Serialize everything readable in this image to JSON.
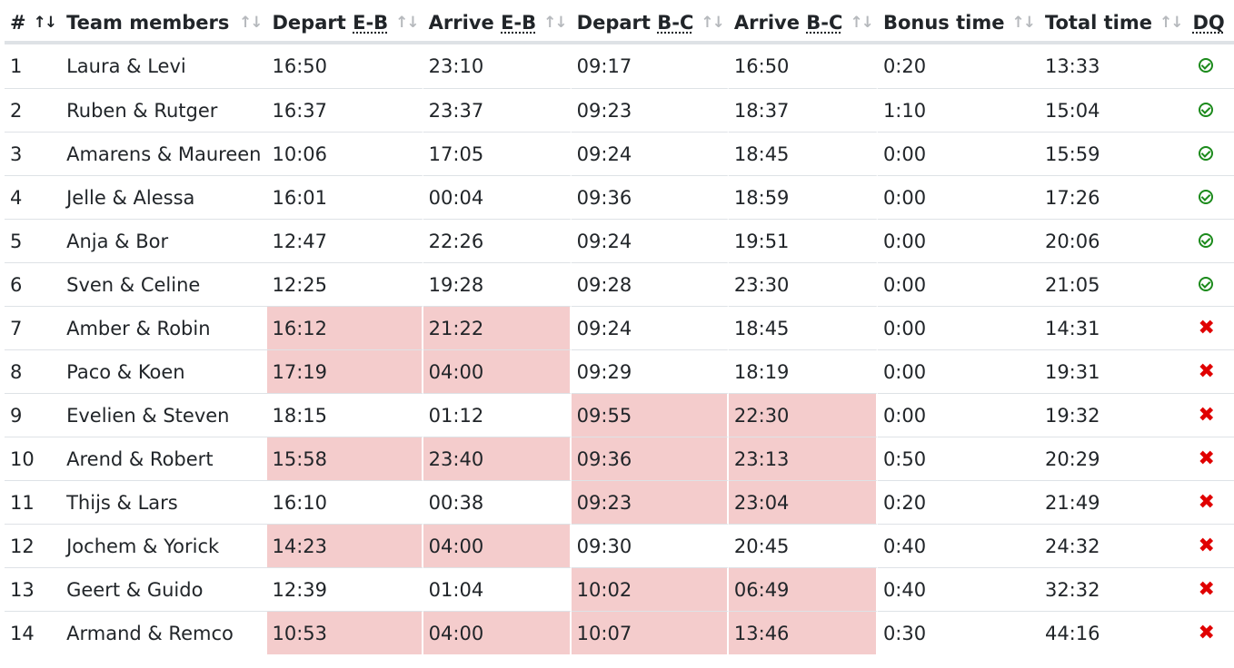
{
  "table": {
    "headers": [
      {
        "name": "col-rank",
        "label": "#",
        "sort": "↑↓",
        "active": true
      },
      {
        "name": "col-team",
        "label": "Team members",
        "sort": "↑↓"
      },
      {
        "name": "col-depart-eb",
        "prefix": "Depart ",
        "abbr": "E-B",
        "sort": "↑↓"
      },
      {
        "name": "col-arrive-eb",
        "prefix": "Arrive ",
        "abbr": "E-B",
        "sort": "↑↓"
      },
      {
        "name": "col-depart-bc",
        "prefix": "Depart ",
        "abbr": "B-C",
        "sort": "↑↓"
      },
      {
        "name": "col-arrive-bc",
        "prefix": "Arrive ",
        "abbr": "B-C",
        "sort": "↑↓"
      },
      {
        "name": "col-bonus",
        "label": "Bonus time",
        "sort": "↑↓"
      },
      {
        "name": "col-total",
        "label": "Total time",
        "sort": "↑↓"
      },
      {
        "name": "col-dq",
        "abbr": "DQ",
        "sort": "↑↓"
      }
    ],
    "rows": [
      {
        "rank": "1",
        "team": "Laura & Levi",
        "depart_eb": "16:50",
        "arrive_eb": "23:10",
        "depart_bc": "09:17",
        "arrive_bc": "16:50",
        "bonus": "0:20",
        "total": "13:33",
        "dq": false,
        "hl_eb": false,
        "hl_bc": false
      },
      {
        "rank": "2",
        "team": "Ruben & Rutger",
        "depart_eb": "16:37",
        "arrive_eb": "23:37",
        "depart_bc": "09:23",
        "arrive_bc": "18:37",
        "bonus": "1:10",
        "total": "15:04",
        "dq": false,
        "hl_eb": false,
        "hl_bc": false
      },
      {
        "rank": "3",
        "team": "Amarens & Maureen",
        "depart_eb": "10:06",
        "arrive_eb": "17:05",
        "depart_bc": "09:24",
        "arrive_bc": "18:45",
        "bonus": "0:00",
        "total": "15:59",
        "dq": false,
        "hl_eb": false,
        "hl_bc": false
      },
      {
        "rank": "4",
        "team": "Jelle & Alessa",
        "depart_eb": "16:01",
        "arrive_eb": "00:04",
        "depart_bc": "09:36",
        "arrive_bc": "18:59",
        "bonus": "0:00",
        "total": "17:26",
        "dq": false,
        "hl_eb": false,
        "hl_bc": false
      },
      {
        "rank": "5",
        "team": "Anja & Bor",
        "depart_eb": "12:47",
        "arrive_eb": "22:26",
        "depart_bc": "09:24",
        "arrive_bc": "19:51",
        "bonus": "0:00",
        "total": "20:06",
        "dq": false,
        "hl_eb": false,
        "hl_bc": false
      },
      {
        "rank": "6",
        "team": "Sven & Celine",
        "depart_eb": "12:25",
        "arrive_eb": "19:28",
        "depart_bc": "09:28",
        "arrive_bc": "23:30",
        "bonus": "0:00",
        "total": "21:05",
        "dq": false,
        "hl_eb": false,
        "hl_bc": false
      },
      {
        "rank": "7",
        "team": "Amber & Robin",
        "depart_eb": "16:12",
        "arrive_eb": "21:22",
        "depart_bc": "09:24",
        "arrive_bc": "18:45",
        "bonus": "0:00",
        "total": "14:31",
        "dq": true,
        "hl_eb": true,
        "hl_bc": false
      },
      {
        "rank": "8",
        "team": "Paco & Koen",
        "depart_eb": "17:19",
        "arrive_eb": "04:00",
        "depart_bc": "09:29",
        "arrive_bc": "18:19",
        "bonus": "0:00",
        "total": "19:31",
        "dq": true,
        "hl_eb": true,
        "hl_bc": false
      },
      {
        "rank": "9",
        "team": "Evelien & Steven",
        "depart_eb": "18:15",
        "arrive_eb": "01:12",
        "depart_bc": "09:55",
        "arrive_bc": "22:30",
        "bonus": "0:00",
        "total": "19:32",
        "dq": true,
        "hl_eb": false,
        "hl_bc": true
      },
      {
        "rank": "10",
        "team": "Arend & Robert",
        "depart_eb": "15:58",
        "arrive_eb": "23:40",
        "depart_bc": "09:36",
        "arrive_bc": "23:13",
        "bonus": "0:50",
        "total": "20:29",
        "dq": true,
        "hl_eb": true,
        "hl_bc": true
      },
      {
        "rank": "11",
        "team": "Thijs & Lars",
        "depart_eb": "16:10",
        "arrive_eb": "00:38",
        "depart_bc": "09:23",
        "arrive_bc": "23:04",
        "bonus": "0:20",
        "total": "21:49",
        "dq": true,
        "hl_eb": false,
        "hl_bc": true
      },
      {
        "rank": "12",
        "team": "Jochem & Yorick",
        "depart_eb": "14:23",
        "arrive_eb": "04:00",
        "depart_bc": "09:30",
        "arrive_bc": "20:45",
        "bonus": "0:40",
        "total": "24:32",
        "dq": true,
        "hl_eb": true,
        "hl_bc": false
      },
      {
        "rank": "13",
        "team": "Geert & Guido",
        "depart_eb": "12:39",
        "arrive_eb": "01:04",
        "depart_bc": "10:02",
        "arrive_bc": "06:49",
        "bonus": "0:40",
        "total": "32:32",
        "dq": true,
        "hl_eb": false,
        "hl_bc": true
      },
      {
        "rank": "14",
        "team": "Armand & Remco",
        "depart_eb": "10:53",
        "arrive_eb": "04:00",
        "depart_bc": "10:07",
        "arrive_bc": "13:46",
        "bonus": "0:30",
        "total": "44:16",
        "dq": true,
        "hl_eb": true,
        "hl_bc": true
      }
    ]
  },
  "icons": {
    "ok": "check-circle-icon",
    "dq": "cross-icon"
  },
  "colors": {
    "highlight": "#f4cccc",
    "ok": "#1b8a1b",
    "dq": "#e00000"
  }
}
